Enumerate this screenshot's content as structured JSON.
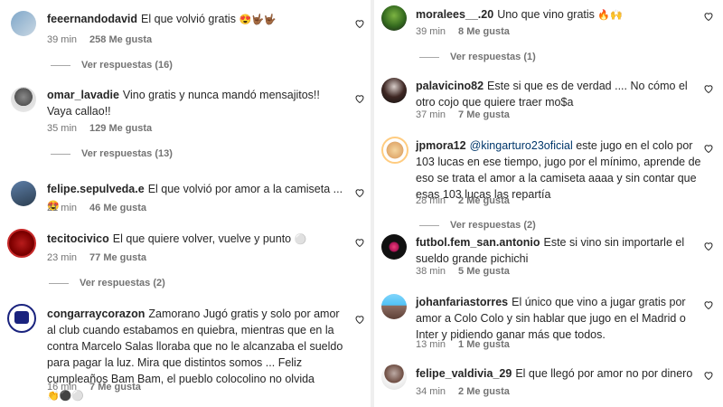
{
  "left": [
    {
      "user": "feeernandodavid",
      "text": "El que volvió gratis",
      "emoji": "😍🤟🏾🤟🏾",
      "time": "39 min",
      "likes": "258 Me gusta",
      "replies": "Ver respuestas (16)"
    },
    {
      "user": "omar_lavadie",
      "text": "Vino gratis y nunca mandó mensajitos!! Vaya callao!!",
      "time": "35 min",
      "likes": "129 Me gusta",
      "replies": "Ver respuestas (13)"
    },
    {
      "user": "felipe.sepulveda.e",
      "text": "El que volvió por amor a la camiseta ...",
      "emoji": "😍",
      "time": "21 min",
      "likes": "46 Me gusta"
    },
    {
      "user": "tecitocivico",
      "text": "El que quiere volver, vuelve y punto",
      "emoji": "⚪",
      "time": "23 min",
      "likes": "77 Me gusta",
      "replies": "Ver respuestas (2)"
    },
    {
      "user": "congarraycorazon",
      "text": "Zamorano Jugó gratis y solo por amor al club cuando estabamos en quiebra, mientras que en la contra Marcelo Salas lloraba que no le alcanzaba el sueldo para pagar la luz. Mira que distintos somos",
      "text2": "... Feliz cumpleaños Bam Bam, el pueblo colocolino no olvida",
      "emoji": "👏⚫⚪",
      "time": "16 min",
      "likes": "7 Me gusta"
    }
  ],
  "right": [
    {
      "user": "moralees__.20",
      "text": "Uno que vino gratis",
      "emoji": "🔥🙌",
      "time": "39 min",
      "likes": "8 Me gusta",
      "replies": "Ver respuestas (1)"
    },
    {
      "user": "palavicino82",
      "text": "Este si que es de verdad .... No cómo el otro cojo que quiere traer mo$a",
      "time": "37 min",
      "likes": "7 Me gusta"
    },
    {
      "user": "jpmora12",
      "mention": "@kingarturo23oficial",
      "text": "este jugo en el colo por 103 lucas en ese tiempo, jugo por el mínimo, aprende de eso se trata el amor a la camiseta aaaa y sin contar que esas 103 lucas las repartía",
      "time": "28 min",
      "likes": "2 Me gusta",
      "replies": "Ver respuestas (2)"
    },
    {
      "user": "futbol.fem_san.antonio",
      "text": "Este si vino sin importarle el sueldo grande pichichi",
      "time": "38 min",
      "likes": "5 Me gusta"
    },
    {
      "user": "johanfariastorres",
      "text": "El único que vino a jugar gratis por amor a Colo Colo y sin hablar que jugo en el Madrid o Inter y pidiendo ganar más que todos.",
      "time": "13 min",
      "likes": "1 Me gusta"
    },
    {
      "user": "felipe_valdivia_29",
      "text": "El que llegó por amor no por dinero",
      "time": "34 min",
      "likes": "2 Me gusta"
    }
  ],
  "icons": {
    "like": "heart-icon",
    "reply_line": "reply-line"
  },
  "colors": {
    "mention": "#00376b",
    "meta": "#737373"
  }
}
